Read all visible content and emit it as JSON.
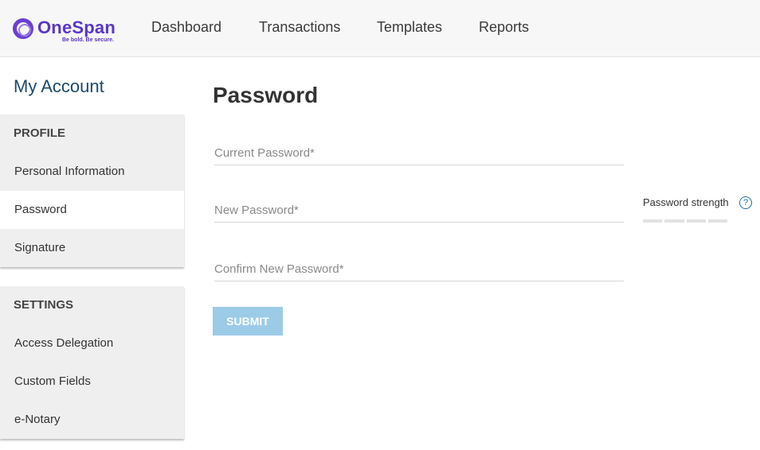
{
  "header": {
    "logo_text": "OneSpan",
    "logo_tagline": "Be bold. Be secure.",
    "nav": [
      "Dashboard",
      "Transactions",
      "Templates",
      "Reports"
    ]
  },
  "sidebar": {
    "title": "My Account",
    "profile": {
      "heading": "PROFILE",
      "items": [
        "Personal Information",
        "Password",
        "Signature"
      ],
      "active": "Password"
    },
    "settings": {
      "heading": "SETTINGS",
      "items": [
        "Access Delegation",
        "Custom Fields",
        "e-Notary"
      ]
    }
  },
  "main": {
    "title": "Password",
    "fields": {
      "current": {
        "placeholder": "Current Password*",
        "value": ""
      },
      "new": {
        "placeholder": "New Password*",
        "value": ""
      },
      "confirm": {
        "placeholder": "Confirm New Password*",
        "value": ""
      }
    },
    "strength": {
      "label": "Password strength",
      "help_icon": "?",
      "level": 0,
      "segments": 4
    },
    "submit_label": "SUBMIT"
  },
  "colors": {
    "brand": "#5a35c9",
    "submit_disabled": "#9ccbe8",
    "link_blue": "#1d6fa8"
  }
}
